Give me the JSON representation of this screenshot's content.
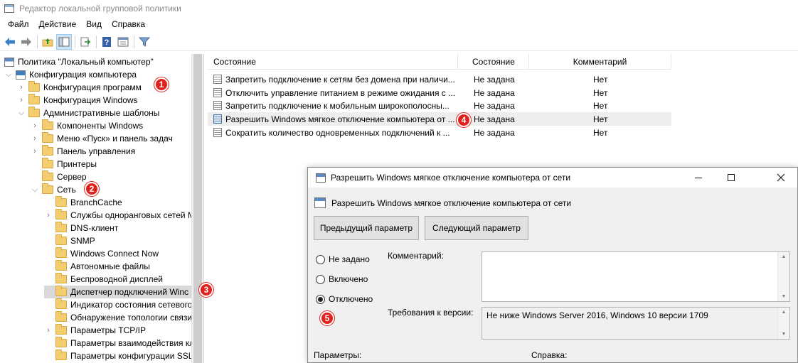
{
  "window": {
    "title": "Редактор локальной групповой политики"
  },
  "menu": [
    "Файл",
    "Действие",
    "Вид",
    "Справка"
  ],
  "tree": {
    "root": "Политика \"Локальный компьютер\"",
    "items": [
      {
        "label": "Конфигурация компьютера",
        "level": 1,
        "expanded": true
      },
      {
        "label": "Конфигурация программ",
        "level": 2,
        "expanded": false
      },
      {
        "label": "Конфигурация Windows",
        "level": 2,
        "expanded": false
      },
      {
        "label": "Административные шаблоны",
        "level": 2,
        "expanded": true
      },
      {
        "label": "Компоненты Windows",
        "level": 3,
        "expanded": false
      },
      {
        "label": "Меню «Пуск» и панель задач",
        "level": 3,
        "expanded": false
      },
      {
        "label": "Панель управления",
        "level": 3,
        "expanded": false
      },
      {
        "label": "Принтеры",
        "level": 3
      },
      {
        "label": "Сервер",
        "level": 3
      },
      {
        "label": "Сеть",
        "level": 3,
        "expanded": true
      },
      {
        "label": "BranchCache",
        "level": 4
      },
      {
        "label": "Службы одноранговых сетей M",
        "level": 4,
        "expanded": false
      },
      {
        "label": "DNS-клиент",
        "level": 4
      },
      {
        "label": "SNMP",
        "level": 4
      },
      {
        "label": "Windows Connect Now",
        "level": 4
      },
      {
        "label": "Автономные файлы",
        "level": 4
      },
      {
        "label": "Беспроводной дисплей",
        "level": 4
      },
      {
        "label": "Диспетчер подключений Winc",
        "level": 4,
        "selected": true
      },
      {
        "label": "Индикатор состояния сетевого",
        "level": 4
      },
      {
        "label": "Обнаружение топологии связи",
        "level": 4
      },
      {
        "label": "Параметры TCP/IP",
        "level": 4,
        "expanded": false
      },
      {
        "label": "Параметры взаимодействия кл",
        "level": 4
      },
      {
        "label": "Параметры конфигурации SSL",
        "level": 4
      }
    ]
  },
  "list": {
    "columns": [
      "Состояние",
      "Состояние",
      "Комментарий"
    ],
    "rows": [
      {
        "name": "Запретить подключение к сетям без домена при наличи...",
        "state": "Не задана",
        "comment": "Нет"
      },
      {
        "name": "Отключить управление питанием в режиме ожидания с ...",
        "state": "Не задана",
        "comment": "Нет"
      },
      {
        "name": "Запретить подключение к мобильным широкополосны...",
        "state": "Не задана",
        "comment": "Нет"
      },
      {
        "name": "Разрешить Windows мягкое отключение компьютера от ...",
        "state": "Не задана",
        "comment": "Нет"
      },
      {
        "name": "Сократить количество одновременных подключений к ...",
        "state": "Не задана",
        "comment": "Нет"
      }
    ]
  },
  "markers": [
    "1",
    "2",
    "3",
    "4",
    "5"
  ],
  "dialog": {
    "title": "Разрешить Windows мягкое отключение компьютера от сети",
    "subtitle": "Разрешить Windows мягкое отключение компьютера от сети",
    "prev_button": "Предыдущий параметр",
    "next_button": "Следующий параметр",
    "options": [
      "Не задано",
      "Включено",
      "Отключено"
    ],
    "selected_option": "Отключено",
    "comment_label": "Комментарий:",
    "comment_value": "",
    "requirements_label": "Требования к версии:",
    "requirements_value": "Не ниже Windows Server 2016, Windows 10 версии 1709",
    "params_label": "Параметры:",
    "help_label": "Справка:"
  },
  "colors": {
    "marker": "#e1211b",
    "selection": "#d9d9d9",
    "folder": "#f3cd6f"
  }
}
